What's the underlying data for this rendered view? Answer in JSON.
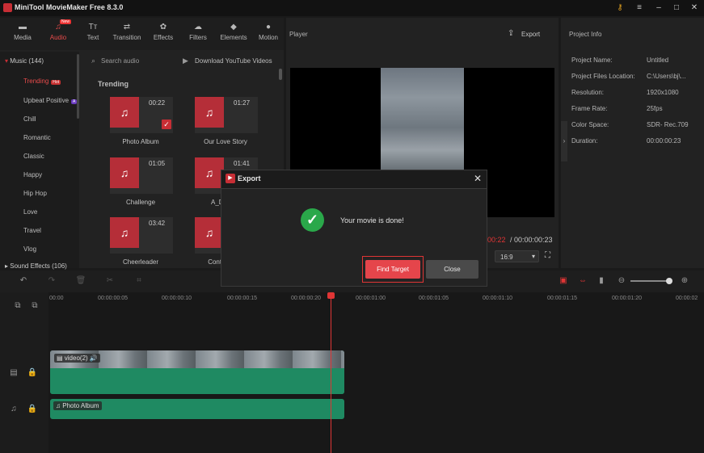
{
  "window": {
    "title": "MiniTool MovieMaker Free 8.3.0",
    "controls": {
      "key": "⚷",
      "menu": "≡",
      "minimize": "–",
      "maximize": "□",
      "close": "✕"
    }
  },
  "tabs": [
    {
      "label": "Media",
      "icon": "▬"
    },
    {
      "label": "Audio",
      "icon": "♫",
      "badge": "New"
    },
    {
      "label": "Text",
      "icon": "Tт"
    },
    {
      "label": "Transition",
      "icon": "⇄"
    },
    {
      "label": "Effects",
      "icon": "✿"
    },
    {
      "label": "Filters",
      "icon": "☁"
    },
    {
      "label": "Elements",
      "icon": "◆"
    },
    {
      "label": "Motion",
      "icon": "●"
    }
  ],
  "music_panel": {
    "category_header": "Music (144)",
    "categories": [
      "Trending",
      "Upbeat Positive",
      "Chill",
      "Romantic",
      "Classic",
      "Happy",
      "Hip Hop",
      "Love",
      "Travel",
      "Vlog"
    ],
    "hot_badge": "Hot",
    "i_badge": "A",
    "sound_effects": "Sound Effects (106)",
    "search_placeholder": "Search audio",
    "download_link": "Download YouTube Videos",
    "section_title": "Trending",
    "cards": [
      {
        "duration": "00:22",
        "label": "Photo Album"
      },
      {
        "duration": "01:27",
        "label": "Our Love Story"
      },
      {
        "duration": "01:05",
        "label": "Challenge"
      },
      {
        "duration": "01:41",
        "label": "A_Du"
      },
      {
        "duration": "03:42",
        "label": "Cheerleader"
      },
      {
        "duration": "",
        "label": "Controll"
      }
    ]
  },
  "player": {
    "title": "Player",
    "export_label": "Export",
    "current_time": "00:22",
    "total_time": "/ 00:00:00:23",
    "aspect": "16:9"
  },
  "project_info": {
    "title": "Project Info",
    "rows": [
      {
        "k": "Project Name:",
        "v": "Untitled"
      },
      {
        "k": "Project Files Location:",
        "v": "C:\\Users\\bj\\..."
      },
      {
        "k": "Resolution:",
        "v": "1920x1080"
      },
      {
        "k": "Frame Rate:",
        "v": "25fps"
      },
      {
        "k": "Color Space:",
        "v": "SDR- Rec.709"
      },
      {
        "k": "Duration:",
        "v": "00:00:00:23"
      }
    ]
  },
  "timeline": {
    "ruler": [
      "00:00",
      "00:00:00:05",
      "00:00:00:10",
      "00:00:00:15",
      "00:00:00:20",
      "00:00:01:00",
      "00:00:01:05",
      "00:00:01:10",
      "00:00:01:15",
      "00:00:01:20",
      "00:00:02"
    ],
    "video_clip_label": "video(2)",
    "audio_clip_label": "Photo Album"
  },
  "export_dialog": {
    "title": "Export",
    "message": "Your movie is done!",
    "find_target": "Find Target",
    "close": "Close"
  },
  "colors": {
    "accent": "#e5454b",
    "success": "#2aa84a",
    "clip": "#1f8a62"
  }
}
